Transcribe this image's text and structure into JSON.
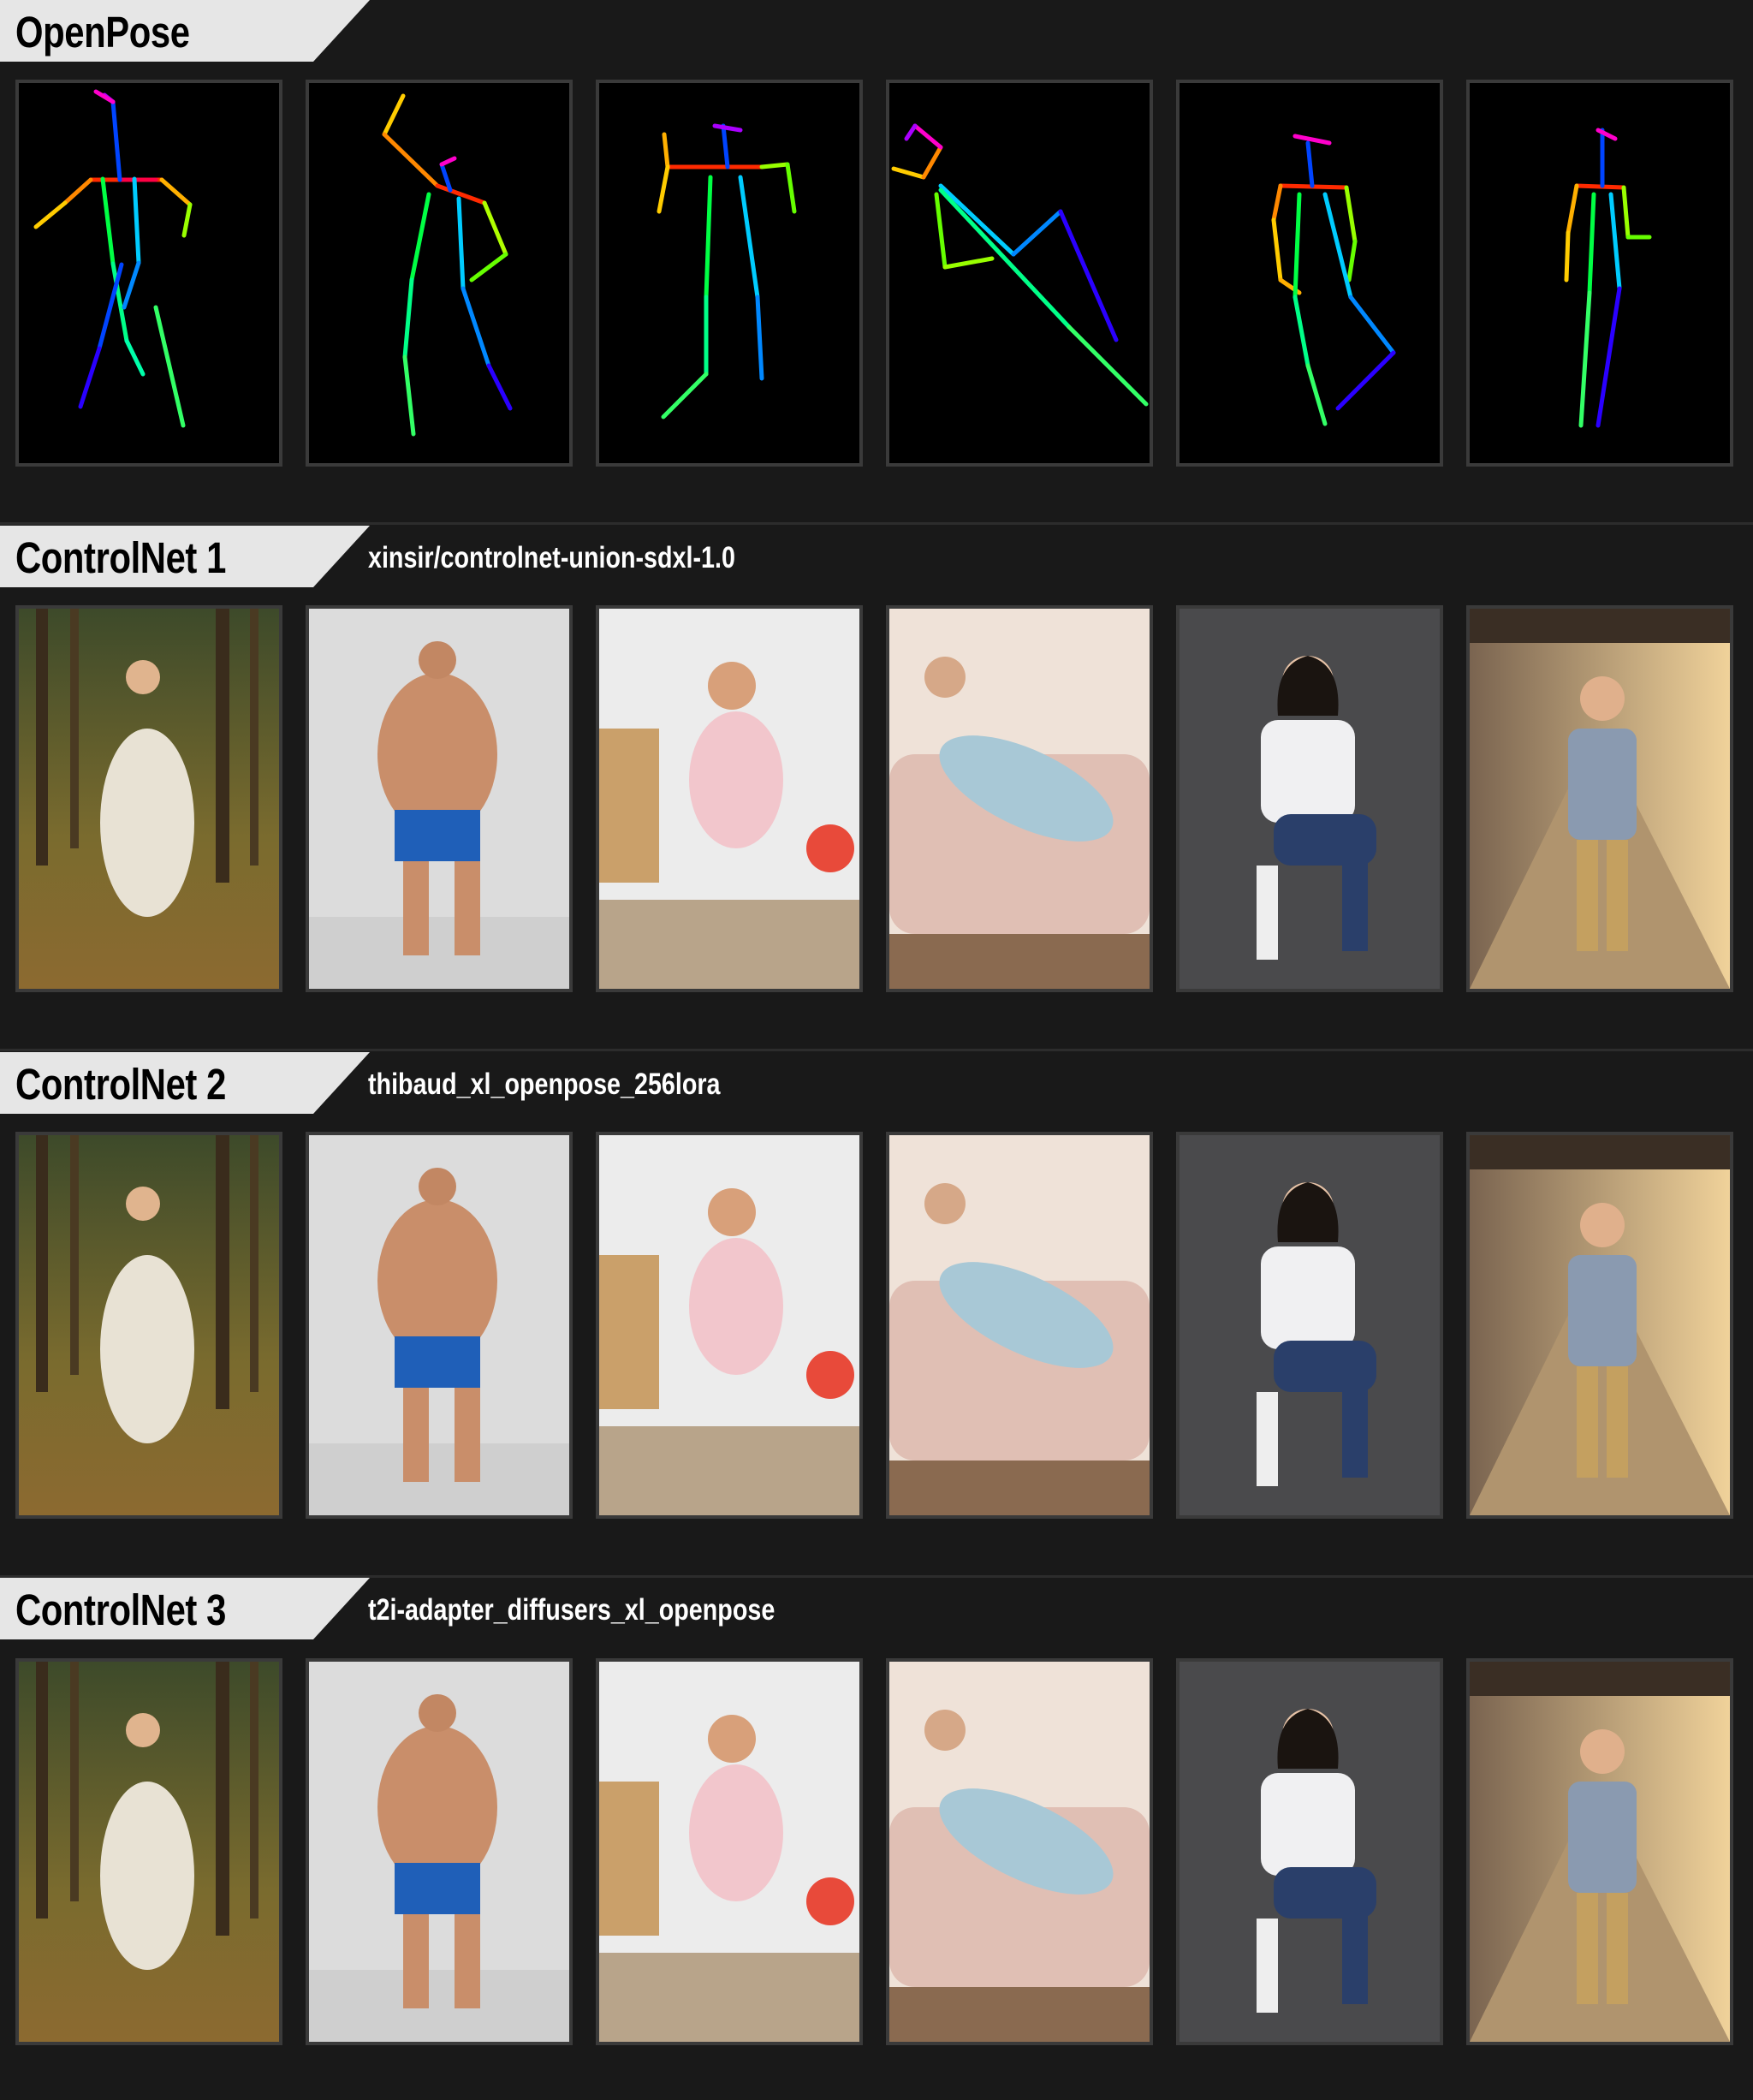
{
  "sections": [
    {
      "title": "OpenPose",
      "model": ""
    },
    {
      "title": "ControlNet 1",
      "model": "xinsir/controlnet-union-sdxl-1.0"
    },
    {
      "title": "ControlNet 2",
      "model": "thibaud_xl_openpose_256lora"
    },
    {
      "title": "ControlNet 3",
      "model": "t2i-adapter_diffusers_xl_openpose"
    }
  ],
  "photos": [
    [
      "forest-dancer-white-dress",
      "bodybuilder-blue-shorts",
      "girl-jumping-playroom",
      "old-man-lounging-sofa",
      "woman-sitting-chair",
      "boy-standing-train-platform"
    ],
    [
      "forest-dancer-white-dress",
      "bodybuilder-blue-briefs",
      "girl-jumping-playroom",
      "old-man-lounging-sofa",
      "woman-sitting-chair",
      "boy-standing-train-platform"
    ],
    [
      "forest-dancer-white-dress",
      "bodybuilder-blue-shorts",
      "girl-jumping-playroom",
      "old-man-lounging-sofa",
      "woman-sitting-box",
      "boy-standing-train-platform"
    ]
  ],
  "colors": {
    "background": "#191919",
    "banner": "#e6e6e6",
    "tile_border": "#3a3a3a"
  }
}
